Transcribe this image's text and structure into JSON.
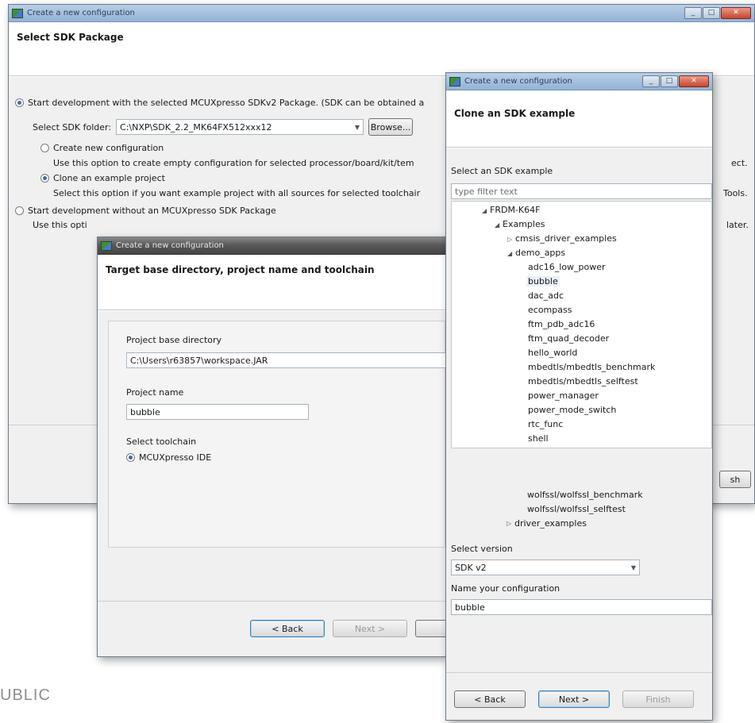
{
  "footer_text": "UBLIC",
  "window1": {
    "title": "Create a new configuration",
    "header": "Select SDK Package",
    "options": {
      "with_sdk": "Start development with the selected MCUXpresso SDKv2 Package. (SDK can be obtained a",
      "sdk_folder_label": "Select SDK folder:",
      "sdk_folder_value": "C:\\NXP\\SDK_2.2_MK64FX512xxx12",
      "browse_label": "Browse...",
      "create_new": "Create new configuration",
      "create_new_desc": "Use this option to create empty configuration for selected processor/board/kit/tem",
      "create_new_desc_tail": "ect.",
      "clone": "Clone an example project",
      "clone_desc": "Select this option if you want example project with all sources for selected toolchair",
      "clone_desc_tail": "Tools.",
      "without_sdk": "Start development without an MCUXpresso SDK Package",
      "without_sdk_desc": "Use this opti",
      "without_sdk_desc_tail": "later."
    },
    "finish_partial": "sh"
  },
  "window2": {
    "title": "Create a new configuration",
    "header": "Target base directory, project name and toolchain",
    "base_dir_label": "Project base directory",
    "base_dir_value": "C:\\Users\\r63857\\workspace.JAR",
    "project_name_label": "Project name",
    "project_name_value": "bubble",
    "toolchain_label": "Select toolchain",
    "toolchain_option": "MCUXpresso IDE",
    "back_label": "< Back",
    "next_label": "Next >"
  },
  "window3": {
    "title": "Create a new configuration",
    "header": "Clone an SDK example",
    "select_example_label": "Select an SDK example",
    "filter_placeholder": "type filter text",
    "tree": {
      "board": "FRDM-K64F",
      "examples": "Examples",
      "cmsis": "cmsis_driver_examples",
      "demo_apps": "demo_apps",
      "items": [
        "adc16_low_power",
        "bubble",
        "dac_adc",
        "ecompass",
        "ftm_pdb_adc16",
        "ftm_quad_decoder",
        "hello_world",
        "mbedtls/mbedtls_benchmark",
        "mbedtls/mbedtls_selftest",
        "power_manager",
        "power_mode_switch",
        "rtc_func",
        "shell",
        "wolfssl/wolfssl_benchmark",
        "wolfssl/wolfssl_selftest"
      ],
      "driver_examples": "driver_examples"
    },
    "select_version_label": "Select version",
    "version_value": "SDK v2",
    "name_config_label": "Name your configuration",
    "name_config_value": "bubble",
    "back_label": "< Back",
    "next_label": "Next >",
    "finish_label": "Finish"
  }
}
